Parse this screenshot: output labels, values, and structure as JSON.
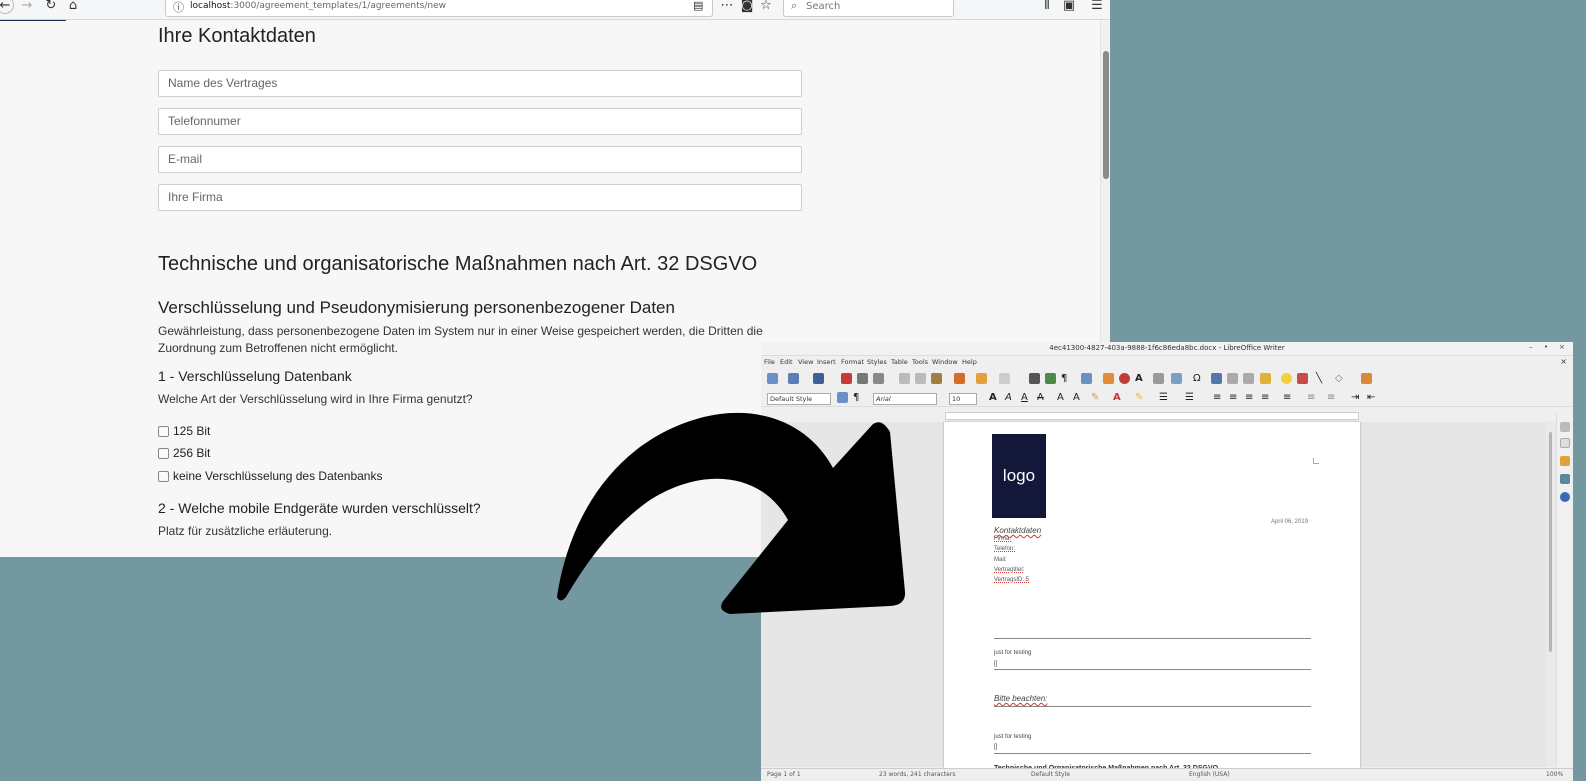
{
  "browser": {
    "url_host": "localhost",
    "url_path": ":3000/agreement_templates/1/agreements/new",
    "search_placeholder": "Search"
  },
  "contact": {
    "heading": "Ihre Kontaktdaten",
    "fields": [
      {
        "placeholder": "Name des Vertrages"
      },
      {
        "placeholder": "Telefonnumer"
      },
      {
        "placeholder": "E-mail"
      },
      {
        "placeholder": "Ihre Firma"
      }
    ]
  },
  "toms": {
    "heading": "Technische und organisatorische Maßnahmen nach Art. 32 DSGVO",
    "section1": {
      "heading": "Verschlüsselung und Pseudonymisierung personenbezogener Daten",
      "description": "Gewährleistung, dass personenbezogene Daten im System nur in einer Weise gespeichert werden, die Dritten die Zuordnung zum Betroffenen nicht ermöglicht."
    },
    "q1": {
      "heading": "1 - Verschlüsselung Datenbank",
      "question": "Welche Art der Verschlüsselung wird in Ihre Firma genutzt?",
      "options": [
        "125 Bit",
        "256 Bit",
        "keine Verschlüsselung des Datenbanks"
      ]
    },
    "q2": {
      "heading": "2 - Welche mobile Endgeräte wurden verschlüsselt?",
      "hint": "Platz für zusätzliche erläuterung."
    }
  },
  "writer": {
    "title": "4ec41300-4827-403a-9888-1f6c86eda8bc.docx - LibreOffice Writer",
    "menu": [
      "File",
      "Edit",
      "View",
      "Insert",
      "Format",
      "Styles",
      "Table",
      "Tools",
      "Window",
      "Help"
    ],
    "paragraph_style": "Default Style",
    "font_name": "Arial",
    "font_size": "10",
    "doc": {
      "logo_text": "logo",
      "date": "April 06, 2019",
      "kontakt_heading": "Kontaktdaten",
      "kontakt_lines": [
        "Firma:",
        "Telefon:",
        "Mail:",
        "Vertragtitel:",
        "VertragsID: 5"
      ],
      "testing1": "just for testing",
      "bracket1": "[]",
      "bitte": "Bitte beachten:",
      "testing2": "just for testing",
      "bracket2": "[]",
      "bottom_heading": "Technische und Organisatorische Maßnahmen nach Art. 32 DSGVO"
    },
    "status": {
      "page": "Page 1 of 1",
      "words": "23 words, 241 characters",
      "style": "Default Style",
      "language": "English (USA)",
      "zoom": "100%"
    }
  }
}
